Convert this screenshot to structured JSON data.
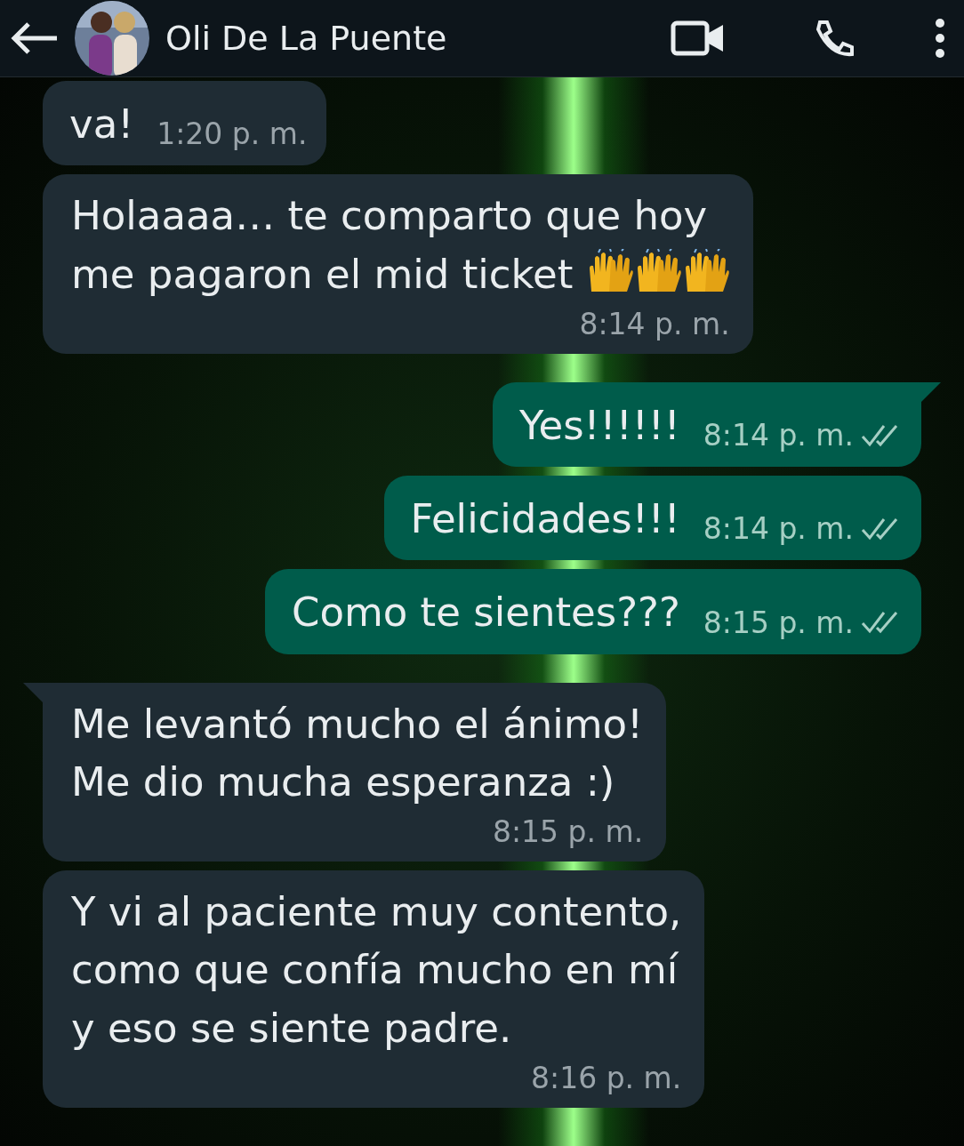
{
  "header": {
    "contact_name": "Oli De La Puente"
  },
  "messages": [
    {
      "kind": "incoming",
      "text": "va!",
      "time": "1:20 p. m.",
      "tail": false,
      "raised_hands_emoji": false
    },
    {
      "kind": "incoming",
      "text": "Holaaaa… te comparto que hoy\nme pagaron el mid ticket",
      "time": "8:14 p. m.",
      "tail": false,
      "raised_hands_emoji": true
    },
    {
      "kind": "outgoing",
      "text": "Yes!!!!!!",
      "time": "8:14 p. m.",
      "tail": true,
      "read": false,
      "raised_hands_emoji": false
    },
    {
      "kind": "outgoing",
      "text": "Felicidades!!!",
      "time": "8:14 p. m.",
      "tail": false,
      "read": false,
      "raised_hands_emoji": false
    },
    {
      "kind": "outgoing",
      "text": "Como te sientes???",
      "time": "8:15 p. m.",
      "tail": false,
      "read": false,
      "raised_hands_emoji": false
    },
    {
      "kind": "incoming",
      "text": "Me levantó mucho el ánimo!\nMe dio mucha esperanza :)",
      "time": "8:15 p. m.",
      "tail": true,
      "raised_hands_emoji": false
    },
    {
      "kind": "incoming",
      "text": "Y vi al paciente muy contento,\ncomo que confía mucho en mí\ny eso se siente padre.",
      "time": "8:16 p. m.",
      "tail": false,
      "raised_hands_emoji": false
    }
  ]
}
